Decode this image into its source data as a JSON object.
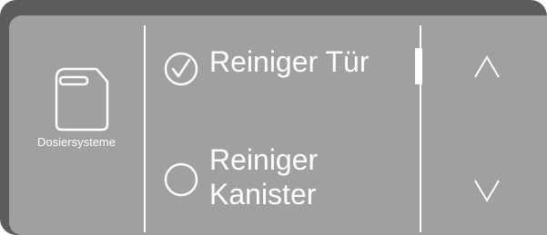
{
  "icon_panel": {
    "icon": "canister-icon",
    "label": "Dosiersysteme"
  },
  "options": [
    {
      "label": "Reiniger Tür",
      "selected": true
    },
    {
      "label": "Reiniger Kanister",
      "label_line1": "Reiniger",
      "label_line2": "Kanister",
      "selected": false
    }
  ],
  "nav": {
    "up_icon": "chevron-up-icon",
    "down_icon": "chevron-down-icon"
  },
  "colors": {
    "bezel": "#5c5c5c",
    "screen": "#a0a0a0",
    "foreground": "#ffffff"
  }
}
